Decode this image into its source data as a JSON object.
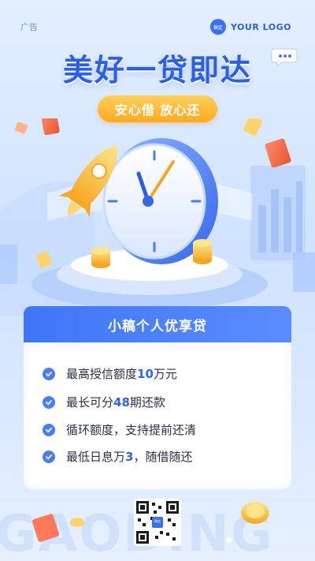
{
  "ad_tag": "广告",
  "logo": {
    "badge": "稿定",
    "text": "YOUR LOGO"
  },
  "headline": "美好一贷即达",
  "slogan": "安心借 放心还",
  "product_title": "小稿个人优享贷",
  "features": [
    {
      "pre": "最高授信额度",
      "hl": "10",
      "post": "万元"
    },
    {
      "pre": "最长可分",
      "hl": "48",
      "post": "期还款"
    },
    {
      "pre": "循环额度，支持提前还清",
      "hl": "",
      "post": ""
    },
    {
      "pre": "最低日息万",
      "hl": "3",
      "post": "，随借随还"
    }
  ],
  "qr_center": "稿定",
  "watermark": "GAODING",
  "colors": {
    "primary": "#3f76f5",
    "accent": "#ffa91f",
    "background": "#d9e8ff"
  }
}
